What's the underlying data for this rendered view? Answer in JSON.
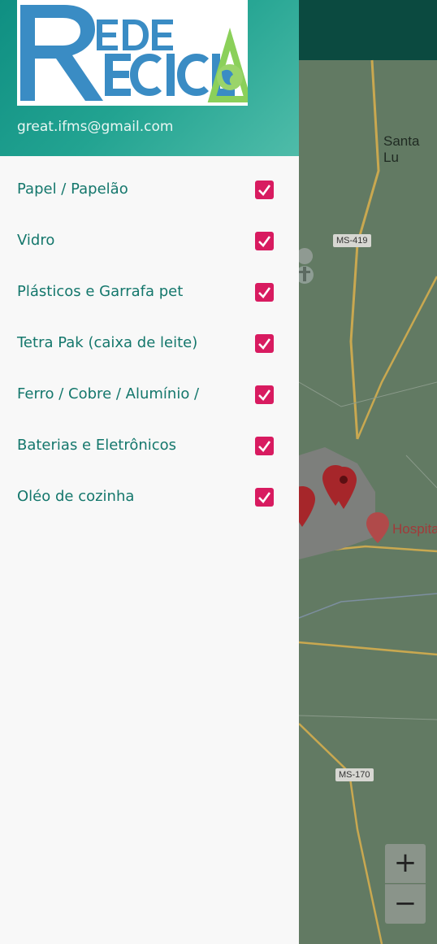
{
  "app": {
    "logo_line1": "EDE",
    "logo_line2": "ECICL",
    "logo_initial": "R"
  },
  "user": {
    "email": "great.ifms@gmail.com"
  },
  "menu": {
    "items": [
      {
        "label": "Papel / Papelão",
        "checked": true
      },
      {
        "label": "Vidro",
        "checked": true
      },
      {
        "label": "Plásticos e Garrafa pet",
        "checked": true
      },
      {
        "label": "Tetra Pak (caixa de leite)",
        "checked": true
      },
      {
        "label": "Ferro / Cobre / Alumínio /",
        "checked": true
      },
      {
        "label": "Baterias e Eletrônicos",
        "checked": true
      },
      {
        "label": "Oléo de cozinha",
        "checked": true
      }
    ]
  },
  "map": {
    "place_label": "Santa Lu",
    "road_1": "MS-419",
    "road_2": "MS-170",
    "hospital_label": "Hospita",
    "zoom_in": "+",
    "zoom_out": "−"
  },
  "colors": {
    "accent": "#d81b60",
    "header_teal": "#22a391",
    "text_teal": "#14776c",
    "app_bar": "#0b4a40"
  }
}
